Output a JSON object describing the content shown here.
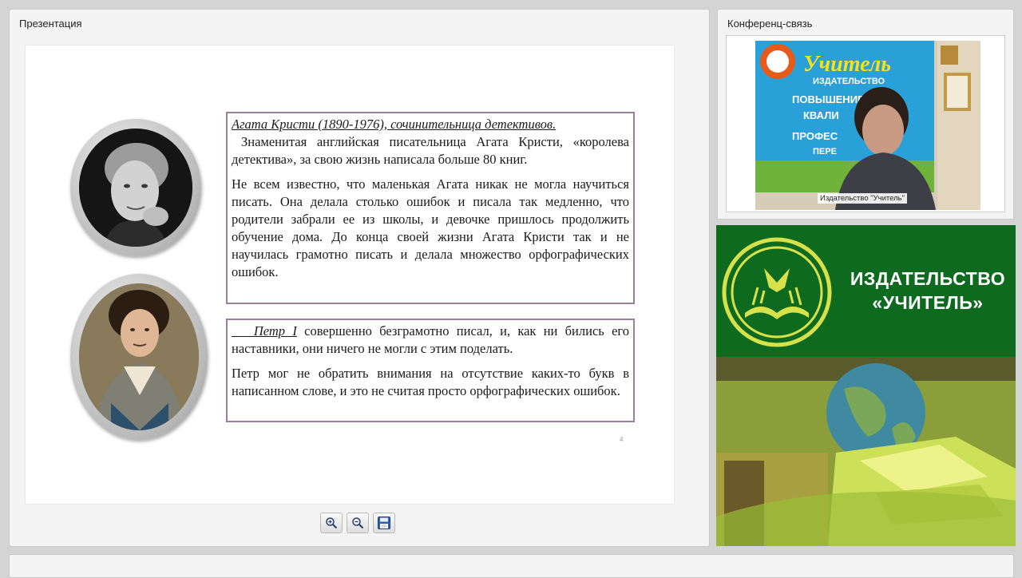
{
  "presentation": {
    "title": "Презентация",
    "page_number": "4",
    "box1": {
      "heading": "Агата Кристи (1890-1976), сочинительница детективов.",
      "para1": "Знаменитая английская писательница Агата Кристи, «королева детектива», за свою жизнь написала больше 80 книг.",
      "para2": "Не всем известно, что маленькая Агата никак не могла научиться писать. Она делала столько ошибок и писала так медленно, что родители забрали ее из школы, и девочке пришлось продолжить обучение дома. До конца своей жизни Агата Кристи так и не научилась грамотно писать и делала множество орфографических ошибок."
    },
    "box2": {
      "name": "Петр I",
      "para1_rest": "совершенно безграмотно писал, и, как ни бились его наставники, они ничего не могли с этим поделать.",
      "para2": "Петр мог не обратить внимания на отсутствие каких-то букв в написанном слове, и это не считая просто орфографических ошибок."
    }
  },
  "toolbar": {
    "zoom_in_icon": "zoom-in-icon",
    "zoom_out_icon": "zoom-out-icon",
    "save_icon": "floppy-disk-icon"
  },
  "conference": {
    "title": "Конференц-связь",
    "video_label": "Издательство \"Учитель\"",
    "poster_brand": "Учитель",
    "poster_sub": "ИЗДАТЕЛЬСТВО",
    "poster_line1": "ПОВЫШЕНИЕ",
    "poster_line2": "КВАЛИ",
    "poster_line3": "ПРОФЕС",
    "poster_line4": "ПЕРЕ"
  },
  "banner": {
    "line1": "ИЗДАТЕЛЬСТВО",
    "line2": "«УЧИТЕЛЬ»"
  }
}
